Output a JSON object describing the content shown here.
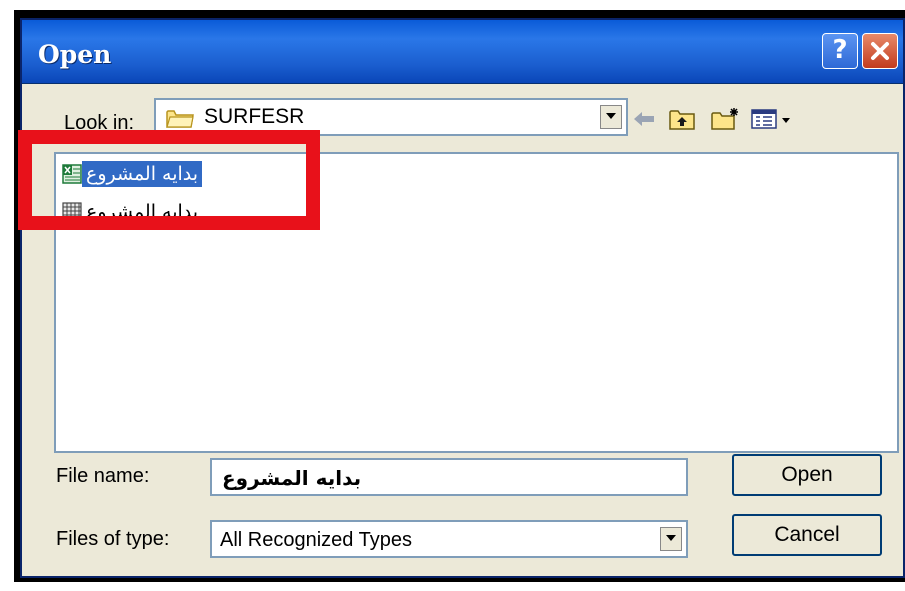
{
  "dialog": {
    "title": "Open",
    "help_label": "?",
    "close_label": "✕"
  },
  "lookin": {
    "label": "Look in:",
    "value": "SURFESR"
  },
  "toolbar": {
    "icons": [
      "back-arrow-icon",
      "up-folder-icon",
      "new-folder-icon",
      "view-menu-icon"
    ]
  },
  "files": [
    {
      "name": "بدايه المشروع",
      "icon": "excel-file-icon",
      "selected": true
    },
    {
      "name": "بدايه المشروع",
      "icon": "data-file-icon",
      "selected": false
    }
  ],
  "filename": {
    "label": "File name:",
    "value": "بدايه المشروع"
  },
  "filetype": {
    "label": "Files of type:",
    "value": "All Recognized Types"
  },
  "buttons": {
    "open": "Open",
    "cancel": "Cancel"
  },
  "colors": {
    "title_bar": "#0a5bd8",
    "selection": "#316ac5",
    "highlight_box": "#e8111a",
    "dialog_bg": "#ece9d8"
  }
}
